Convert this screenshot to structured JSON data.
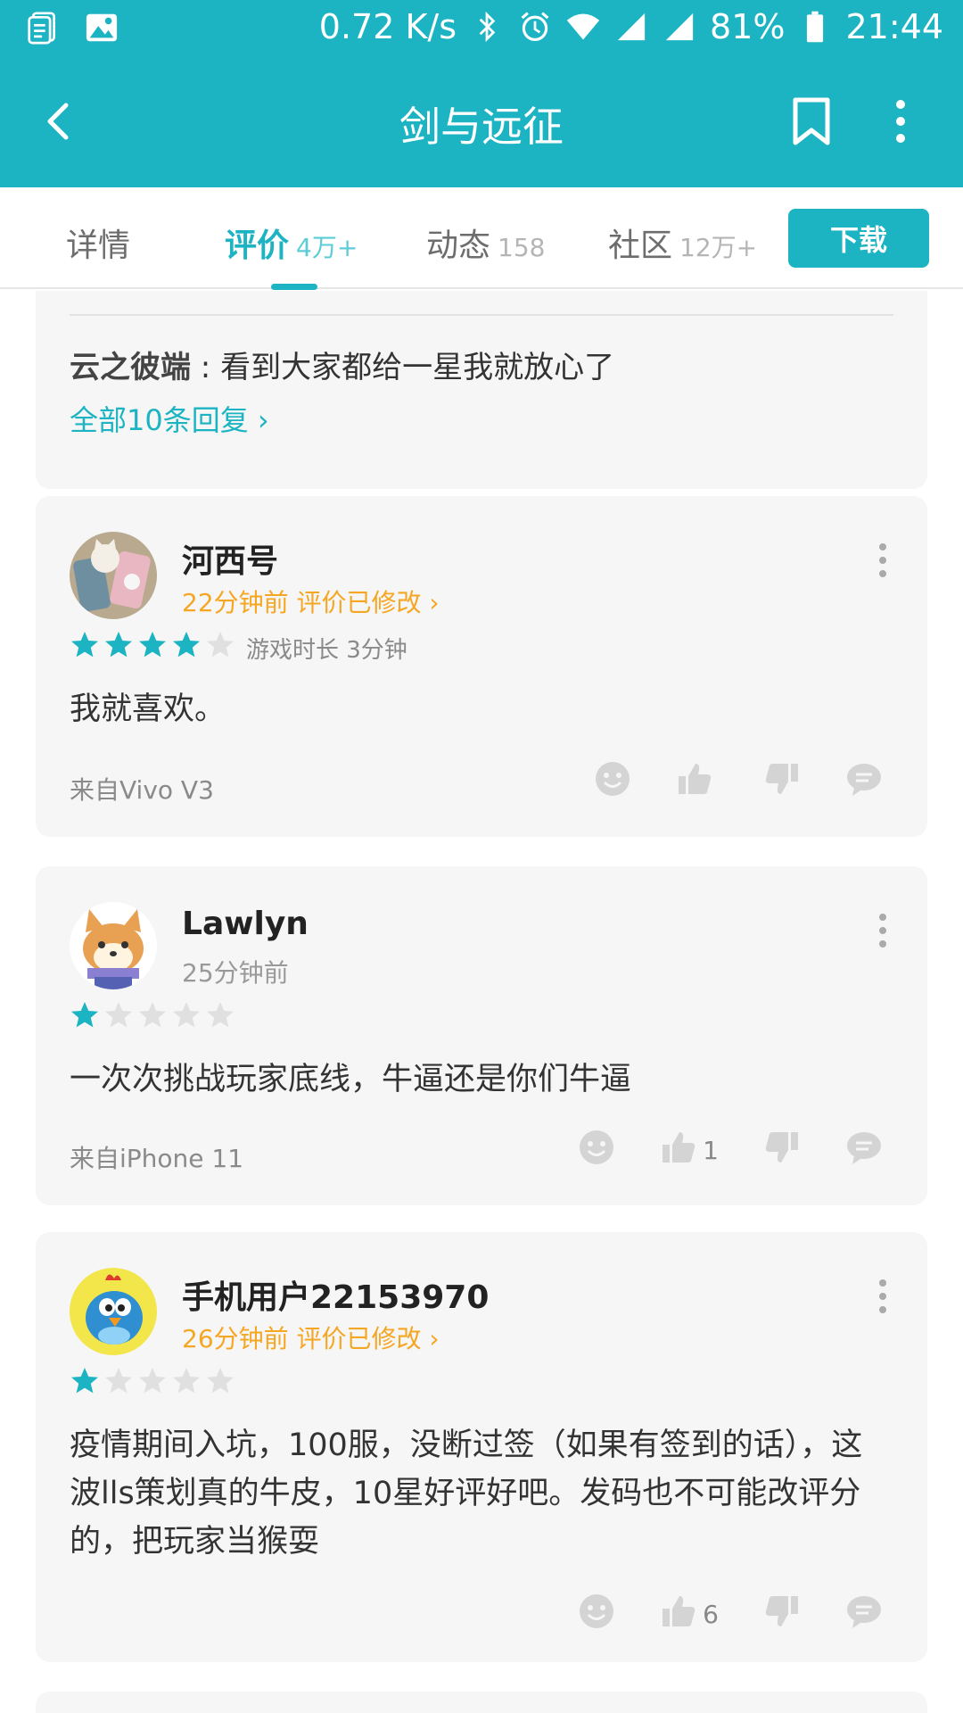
{
  "status_bar": {
    "speed": "0.72 K/s",
    "battery": "81%",
    "time": "21:44"
  },
  "app_bar": {
    "title": "剑与远征"
  },
  "tabs": [
    {
      "label": "详情",
      "count": ""
    },
    {
      "label": "评价",
      "count": "4万+"
    },
    {
      "label": "动态",
      "count": "158"
    },
    {
      "label": "社区",
      "count": "12万+"
    }
  ],
  "download_label": "下载",
  "reply_preview": {
    "author": "云之彼端",
    "separator": " : ",
    "text": "看到大家都给一星我就放心了",
    "all_replies": "全部10条回复 ›"
  },
  "reviews": [
    {
      "username": "河西号",
      "time": "22分钟前 评价已修改 ›",
      "edited": true,
      "rating": 4,
      "playtime": "游戏时长 3分钟",
      "text": "我就喜欢。",
      "device": "来自Vivo V3",
      "likes": ""
    },
    {
      "username": "Lawlyn",
      "time": "25分钟前",
      "edited": false,
      "rating": 1,
      "playtime": "",
      "text": "一次次挑战玩家底线，牛逼还是你们牛逼",
      "device": "来自iPhone 11",
      "likes": "1"
    },
    {
      "username": "手机用户22153970",
      "time": "26分钟前 评价已修改 ›",
      "edited": true,
      "rating": 1,
      "playtime": "",
      "text": "疫情期间入坑，100服，没断过签（如果有签到的话），这波lls策划真的牛皮，10星好评好吧。发码也不可能改评分的，把玩家当猴耍",
      "device": "",
      "likes": "6"
    }
  ],
  "colors": {
    "accent": "#1cb4c2",
    "edited": "#f5a623",
    "star_off": "#e0e0e0"
  }
}
